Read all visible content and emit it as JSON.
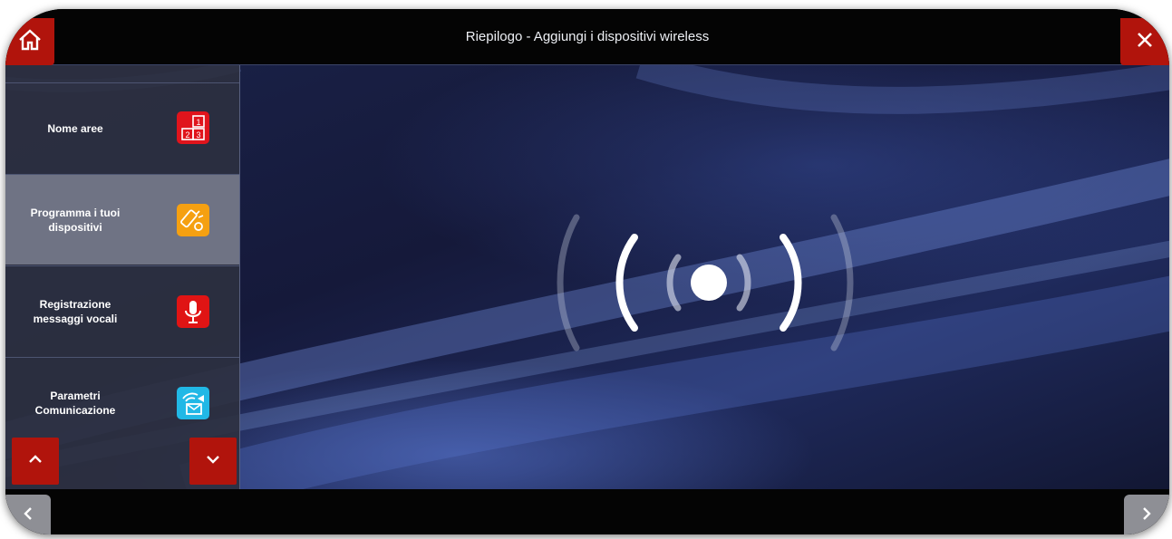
{
  "header": {
    "title": "Riepilogo - Aggiungi i dispositivi wireless"
  },
  "toolbar": {
    "home_icon": "home-icon",
    "close_icon": "close-icon"
  },
  "sidebar": {
    "items": [
      {
        "label": "Nome aree",
        "icon": "area-grid-icon",
        "icon_color": "#e0141c",
        "active": false
      },
      {
        "label": "Programma i tuoi dispositivi",
        "icon": "key-fob-icon",
        "icon_color": "#f5a011",
        "active": true
      },
      {
        "label": "Registrazione messaggi vocali",
        "icon": "microphone-icon",
        "icon_color": "#e01414",
        "active": false
      },
      {
        "label": "Parametri Comunicazione",
        "icon": "communication-icon",
        "icon_color": "#21b8e6",
        "active": false
      }
    ],
    "scroll_up_icon": "chevron-up-icon",
    "scroll_down_icon": "chevron-down-icon"
  },
  "main": {
    "status_icon": "wireless-signal-icon"
  },
  "footer": {
    "back_icon": "chevron-left-icon",
    "forward_icon": "chevron-right-icon"
  },
  "colors": {
    "accent": "#b1140c",
    "sidebar_bg": "#2c3040",
    "active_item": "#6f7384",
    "main_bg": "#1a2248"
  }
}
